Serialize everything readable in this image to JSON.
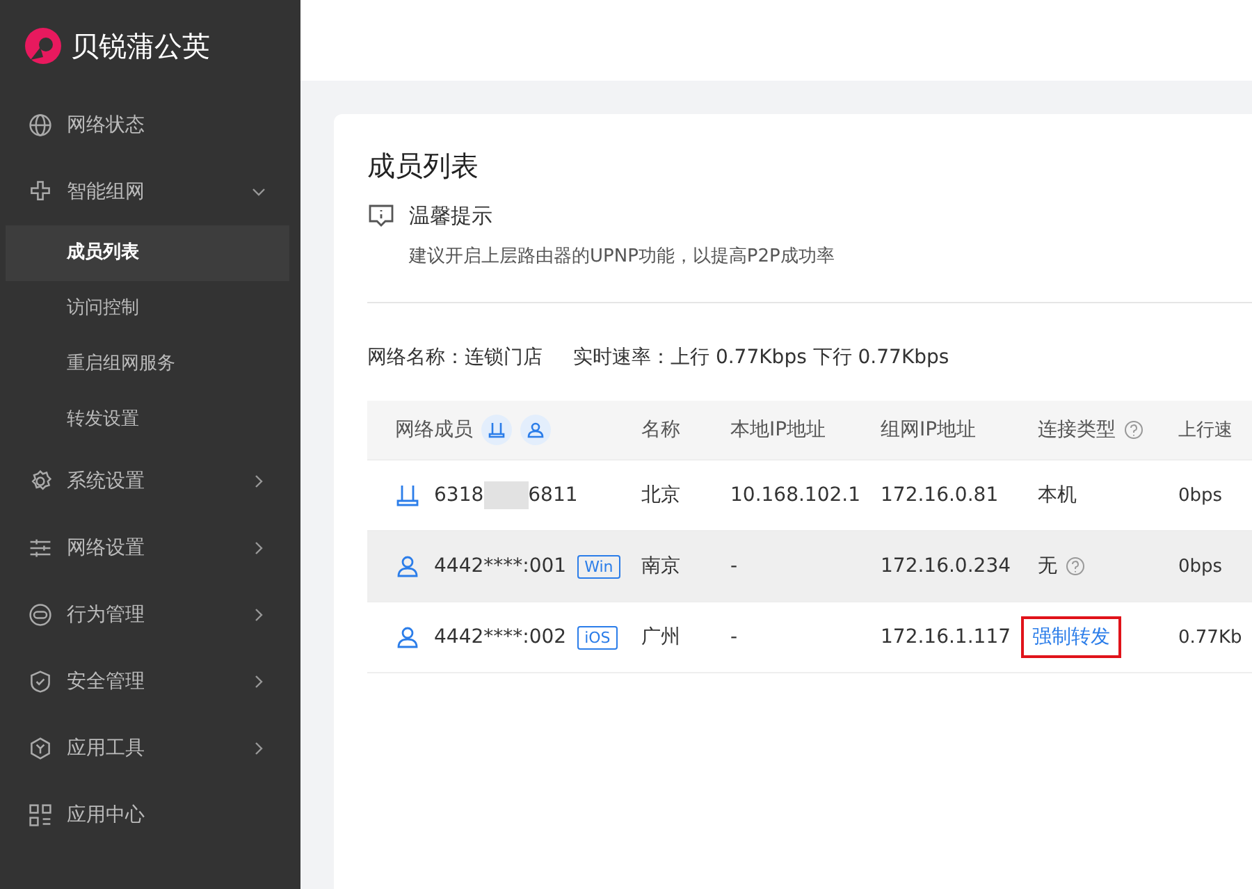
{
  "brand": {
    "name": "贝锐蒲公英"
  },
  "sidebar": {
    "items": [
      {
        "label": "网络状态",
        "kind": "plain"
      },
      {
        "label": "智能组网",
        "kind": "group",
        "expanded": true,
        "children": [
          {
            "label": "成员列表",
            "selected": true
          },
          {
            "label": "访问控制",
            "selected": false
          },
          {
            "label": "重启组网服务",
            "selected": false
          },
          {
            "label": "转发设置",
            "selected": false
          }
        ]
      },
      {
        "label": "系统设置",
        "kind": "group",
        "expanded": false
      },
      {
        "label": "网络设置",
        "kind": "group",
        "expanded": false
      },
      {
        "label": "行为管理",
        "kind": "group",
        "expanded": false
      },
      {
        "label": "安全管理",
        "kind": "group",
        "expanded": false
      },
      {
        "label": "应用工具",
        "kind": "group",
        "expanded": false
      },
      {
        "label": "应用中心",
        "kind": "plain"
      }
    ]
  },
  "page": {
    "title": "成员列表",
    "tip": {
      "title": "温馨提示",
      "text": "建议开启上层路由器的UPNP功能，以提高P2P成功率"
    },
    "network_name": {
      "label": "网络名称：",
      "value": "连锁门店"
    },
    "speed": {
      "label": "实时速率：",
      "value": "上行 0.77Kbps 下行 0.77Kbps"
    },
    "table": {
      "columns": [
        "网络成员",
        "名称",
        "本地IP地址",
        "组网IP地址",
        "连接类型",
        "上行速"
      ],
      "rows": [
        {
          "kind": "router",
          "member": [
            "6318",
            "6811"
          ],
          "name": "北京",
          "local_ip": "10.168.102.1",
          "vpn_ip": "172.16.0.81",
          "conn": {
            "kind": "text",
            "text": "本机",
            "highlighted": false
          },
          "up": "0bps",
          "hover": false
        },
        {
          "kind": "user",
          "member": [
            "4442****:001"
          ],
          "tag": "Win",
          "name": "南京",
          "local_ip": "-",
          "vpn_ip": "172.16.0.234",
          "conn": {
            "kind": "help",
            "text": "无",
            "highlighted": false
          },
          "up": "0bps",
          "hover": true
        },
        {
          "kind": "user",
          "member": [
            "4442****:002"
          ],
          "tag": "iOS",
          "name": "广州",
          "local_ip": "-",
          "vpn_ip": "172.16.1.117",
          "conn": {
            "kind": "link",
            "text": "强制转发",
            "highlighted": true
          },
          "up": "0.77Kb",
          "hover": false
        }
      ]
    }
  }
}
